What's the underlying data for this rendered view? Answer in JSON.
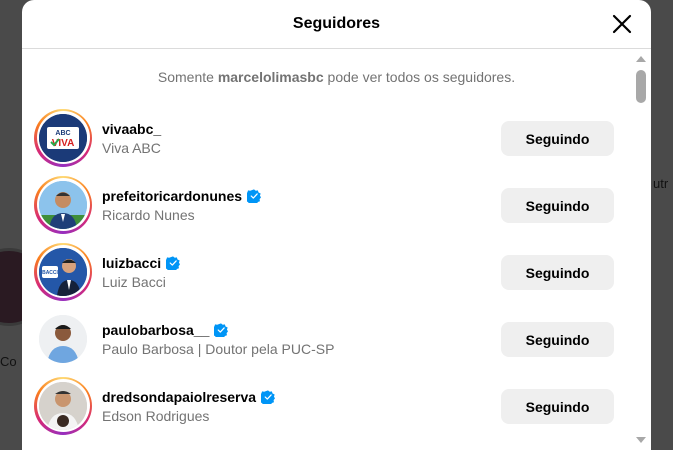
{
  "background": {
    "left_text": "Co",
    "right_text": "utr"
  },
  "modal": {
    "title": "Seguidores",
    "close_icon": "close-icon",
    "notice": {
      "prefix": "Somente ",
      "username": "marcelolimasbc",
      "suffix": " pode ver todos os seguidores."
    }
  },
  "followers": [
    {
      "username": "vivaabc_",
      "name": "Viva ABC",
      "verified": false,
      "story_ring": true,
      "button": "Seguindo",
      "avatar_text": "ABC VIVA"
    },
    {
      "username": "prefeitoricardonunes",
      "name": "Ricardo Nunes",
      "verified": true,
      "story_ring": true,
      "button": "Seguindo"
    },
    {
      "username": "luizbacci",
      "name": "Luiz Bacci",
      "verified": true,
      "story_ring": true,
      "button": "Seguindo",
      "avatar_text": "BACCI"
    },
    {
      "username": "paulobarbosa__",
      "name": "Paulo Barbosa | Doutor pela PUC-SP",
      "verified": true,
      "story_ring": false,
      "button": "Seguindo"
    },
    {
      "username": "dredsondapaiolreserva",
      "name": "Edson Rodrigues",
      "verified": true,
      "story_ring": true,
      "button": "Seguindo"
    }
  ],
  "colors": {
    "verified_blue": "#0095f6",
    "button_bg": "#efefef",
    "secondary_text": "#737373"
  }
}
